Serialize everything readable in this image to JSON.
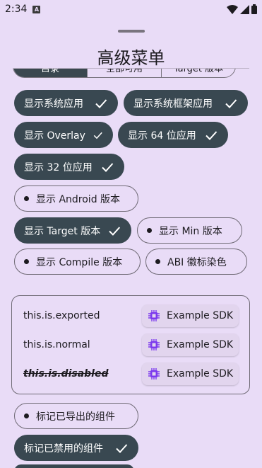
{
  "status_bar": {
    "time": "2:34",
    "notification_letter": "A"
  },
  "sheet": {
    "title": "高级菜单"
  },
  "segments": [
    {
      "label": "目录",
      "selected": true
    },
    {
      "label": "全部可用",
      "selected": false
    },
    {
      "label": "Target 版本",
      "selected": false
    }
  ],
  "chips": [
    {
      "label": "显示系统应用",
      "checked": true
    },
    {
      "label": "显示系统框架应用",
      "checked": true
    },
    {
      "label": "显示 Overlay",
      "checked": true
    },
    {
      "label": "显示 64 位应用",
      "checked": true
    },
    {
      "label": "显示 32 位应用",
      "checked": true
    },
    {
      "label": "显示 Android 版本",
      "checked": false
    },
    {
      "label": "显示 Target 版本",
      "checked": true
    },
    {
      "label": "显示 Min 版本",
      "checked": false
    },
    {
      "label": "显示 Compile 版本",
      "checked": false
    },
    {
      "label": "ABI 徽标染色",
      "checked": false
    }
  ],
  "sdk_preview": [
    {
      "component": "this.is.exported",
      "sdk": "Example SDK",
      "disabled": false
    },
    {
      "component": "this.is.normal",
      "sdk": "Example SDK",
      "disabled": false
    },
    {
      "component": "this.is.disabled",
      "sdk": "Example SDK",
      "disabled": true
    }
  ],
  "bottom_chips": [
    {
      "label": "标记已导出的组件",
      "checked": false
    },
    {
      "label": "标记已禁用的组件",
      "checked": true
    }
  ],
  "colors": {
    "background": "#E9DCF7",
    "chip_selected": "#394851",
    "badge_bg": "#E2D5EE",
    "sdk_icon": "#7C3AED"
  },
  "icons": {
    "check": "check-icon",
    "sdk": "chip-icon",
    "wifi": "wifi-icon",
    "signal": "signal-icon",
    "battery": "battery-icon"
  }
}
